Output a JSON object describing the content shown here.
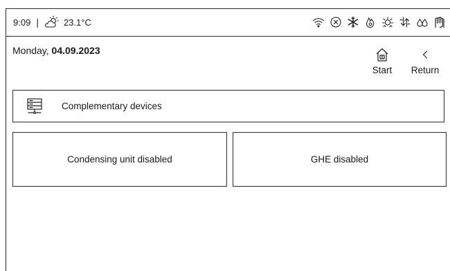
{
  "status": {
    "time": "9:09",
    "separator": "|",
    "temperature": "23.1°C",
    "icons": [
      "wifi-icon",
      "cancel-circle-icon",
      "snowflake-icon",
      "flame-icon",
      "heat-exchanger-icon",
      "air-flow-icon",
      "humidity-icon",
      "hand-control-icon"
    ]
  },
  "date": {
    "weekday": "Monday, ",
    "value": "04.09.2023"
  },
  "nav": {
    "start_label": "Start",
    "return_label": "Return"
  },
  "section": {
    "title": "Complementary devices"
  },
  "tiles": [
    {
      "label": "Condensing unit disabled"
    },
    {
      "label": "GHE disabled"
    }
  ]
}
